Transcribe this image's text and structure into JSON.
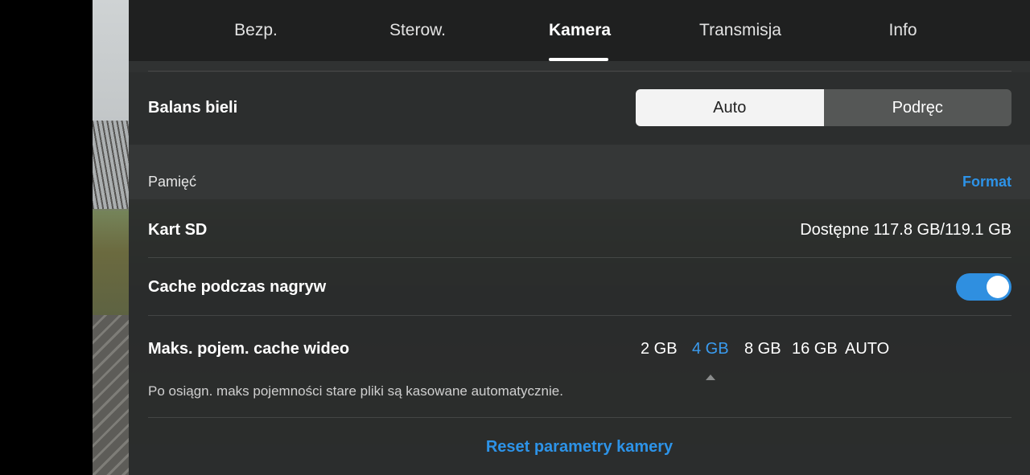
{
  "tabs": [
    {
      "label": "Bezp.",
      "active": false
    },
    {
      "label": "Sterow.",
      "active": false
    },
    {
      "label": "Kamera",
      "active": true
    },
    {
      "label": "Transmisja",
      "active": false
    },
    {
      "label": "Info",
      "active": false
    }
  ],
  "white_balance": {
    "label": "Balans bieli",
    "options": [
      "Auto",
      "Podręc"
    ],
    "selected": "Auto"
  },
  "memory": {
    "section_label": "Pamięć",
    "format_label": "Format",
    "sd_label": "Kart SD",
    "sd_value": "Dostępne 117.8 GB/119.1 GB"
  },
  "cache": {
    "label": "Cache podczas nagryw",
    "enabled": true
  },
  "cache_size": {
    "label": "Maks. pojem. cache wideo",
    "options": [
      "2 GB",
      "4 GB",
      "8 GB",
      "16 GB",
      "AUTO"
    ],
    "selected": "4 GB",
    "hint": "Po osiągn. maks pojemności stare pliki są kasowane automatycznie."
  },
  "reset_label": "Reset parametry kamery",
  "colors": {
    "accent": "#2d93e8",
    "toggle_on": "#2f8fe0",
    "panel_bg": "#2a2c2c"
  }
}
